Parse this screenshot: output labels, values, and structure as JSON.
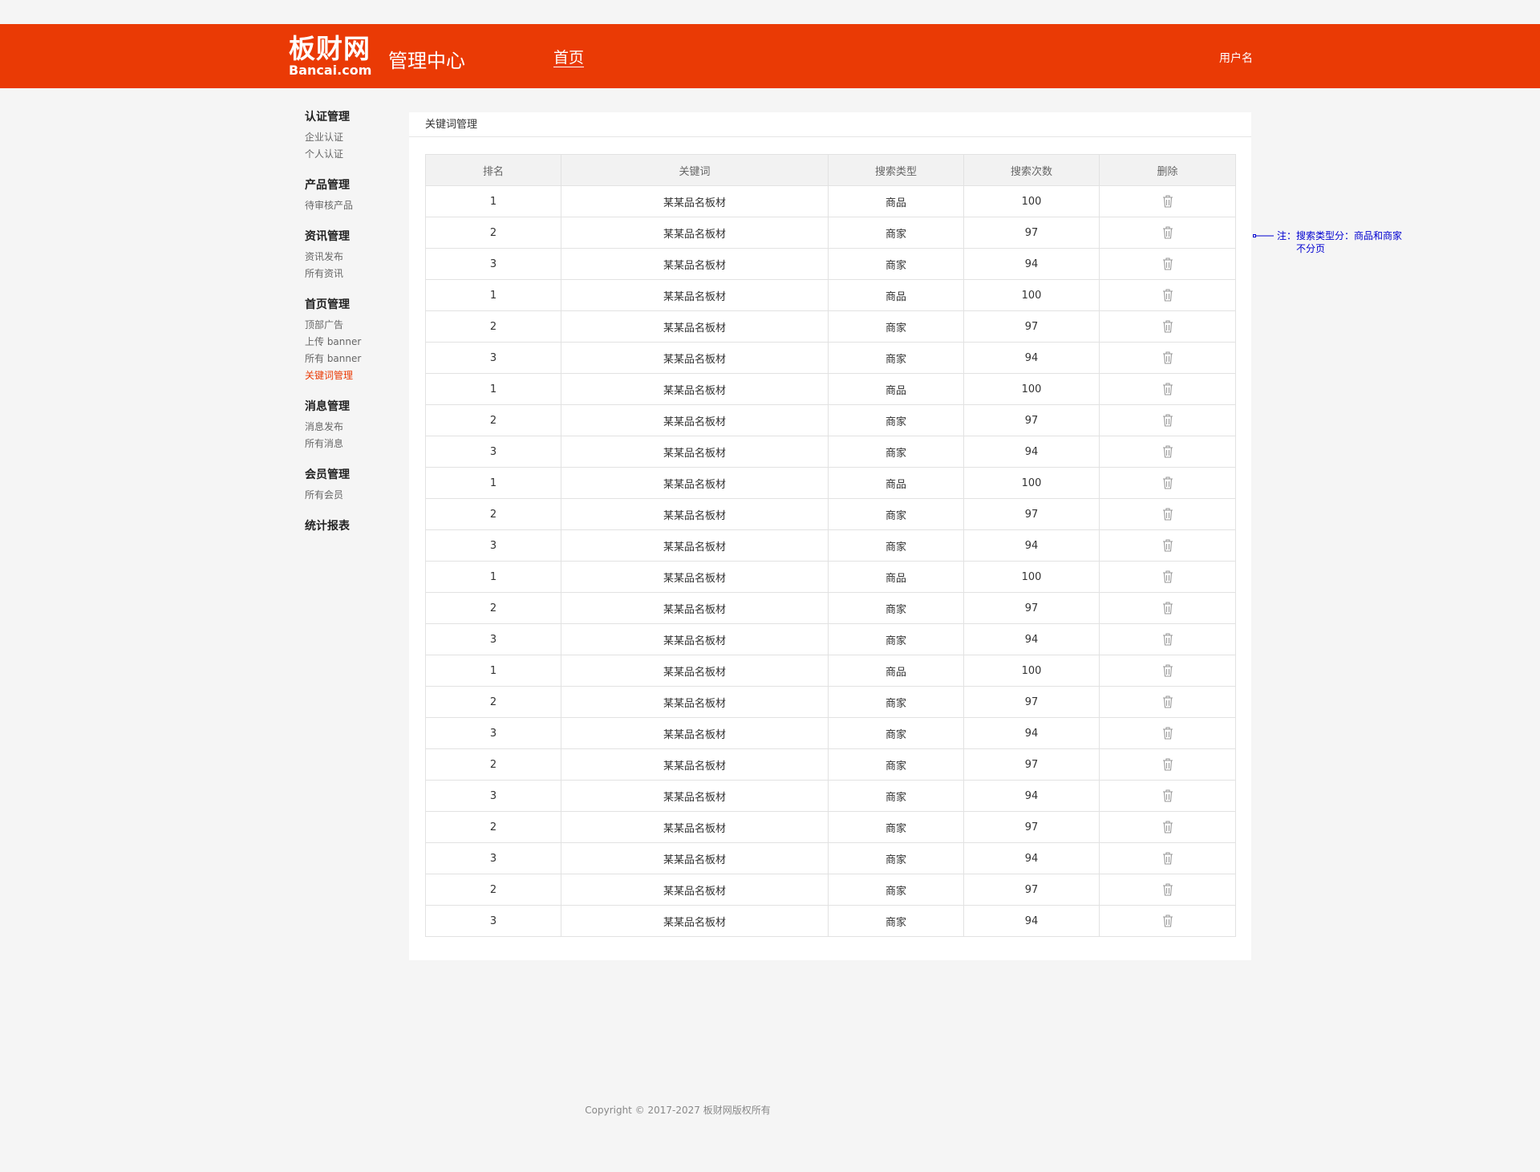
{
  "header": {
    "logo_cn": "板财网",
    "logo_en": "Bancai.com",
    "admin_title": "管理中心",
    "nav_home": "首页",
    "username": "用户名"
  },
  "sidebar": {
    "groups": [
      {
        "title": "认证管理",
        "items": [
          "企业认证",
          "个人认证"
        ]
      },
      {
        "title": "产品管理",
        "items": [
          "待审核产品"
        ]
      },
      {
        "title": "资讯管理",
        "items": [
          "资讯发布",
          "所有资讯"
        ]
      },
      {
        "title": "首页管理",
        "items": [
          "顶部广告",
          "上传 banner",
          "所有 banner",
          "关键词管理"
        ]
      },
      {
        "title": "消息管理",
        "items": [
          "消息发布",
          "所有消息"
        ]
      },
      {
        "title": "会员管理",
        "items": [
          "所有会员"
        ]
      },
      {
        "title": "统计报表",
        "items": []
      }
    ],
    "active_item": "关键词管理"
  },
  "panel": {
    "title": "关键词管理"
  },
  "table": {
    "headers": [
      "排名",
      "关键词",
      "搜索类型",
      "搜索次数",
      "删除"
    ],
    "rows": [
      [
        "1",
        "某某品名板材",
        "商品",
        "100"
      ],
      [
        "2",
        "某某品名板材",
        "商家",
        "97"
      ],
      [
        "3",
        "某某品名板材",
        "商家",
        "94"
      ],
      [
        "1",
        "某某品名板材",
        "商品",
        "100"
      ],
      [
        "2",
        "某某品名板材",
        "商家",
        "97"
      ],
      [
        "3",
        "某某品名板材",
        "商家",
        "94"
      ],
      [
        "1",
        "某某品名板材",
        "商品",
        "100"
      ],
      [
        "2",
        "某某品名板材",
        "商家",
        "97"
      ],
      [
        "3",
        "某某品名板材",
        "商家",
        "94"
      ],
      [
        "1",
        "某某品名板材",
        "商品",
        "100"
      ],
      [
        "2",
        "某某品名板材",
        "商家",
        "97"
      ],
      [
        "3",
        "某某品名板材",
        "商家",
        "94"
      ],
      [
        "1",
        "某某品名板材",
        "商品",
        "100"
      ],
      [
        "2",
        "某某品名板材",
        "商家",
        "97"
      ],
      [
        "3",
        "某某品名板材",
        "商家",
        "94"
      ],
      [
        "1",
        "某某品名板材",
        "商品",
        "100"
      ],
      [
        "2",
        "某某品名板材",
        "商家",
        "97"
      ],
      [
        "3",
        "某某品名板材",
        "商家",
        "94"
      ],
      [
        "2",
        "某某品名板材",
        "商家",
        "97"
      ],
      [
        "3",
        "某某品名板材",
        "商家",
        "94"
      ],
      [
        "2",
        "某某品名板材",
        "商家",
        "97"
      ],
      [
        "3",
        "某某品名板材",
        "商家",
        "94"
      ],
      [
        "2",
        "某某品名板材",
        "商家",
        "97"
      ],
      [
        "3",
        "某某品名板材",
        "商家",
        "94"
      ]
    ],
    "delete_icon": "trash-icon"
  },
  "note": {
    "line1": "注：搜索类型分：商品和商家",
    "line2": "不分页"
  },
  "footer": {
    "copyright": "Copyright © 2017-2027  板财网版权所有"
  },
  "colors": {
    "brand": "#ea3a05",
    "note": "#0000d0"
  }
}
